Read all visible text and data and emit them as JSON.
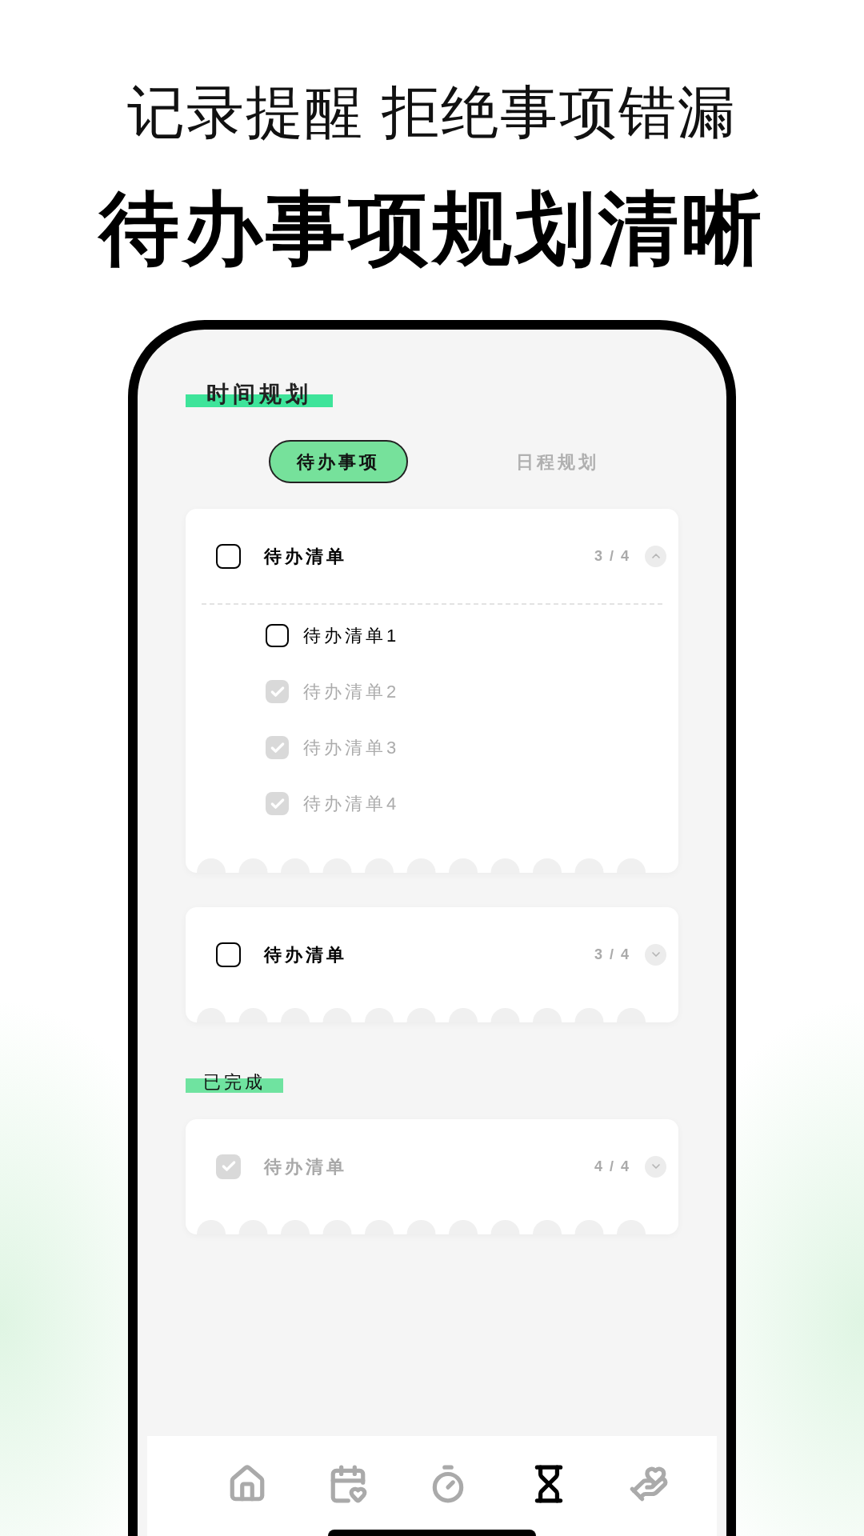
{
  "headline": {
    "line1": "记录提醒 拒绝事项错漏",
    "line2": "待办事项规划清晰"
  },
  "phone": {
    "section_title": "时间规划",
    "tabs": [
      {
        "label": "待办事项",
        "selected": true
      },
      {
        "label": "日程规划",
        "selected": false
      }
    ],
    "groups": [
      {
        "title": "待办清单",
        "checked": false,
        "count": "3 / 4",
        "expanded": true,
        "items": [
          {
            "label": "待办清单1",
            "checked": false
          },
          {
            "label": "待办清单2",
            "checked": true
          },
          {
            "label": "待办清单3",
            "checked": true
          },
          {
            "label": "待办清单4",
            "checked": true
          }
        ]
      },
      {
        "title": "待办清单",
        "checked": false,
        "count": "3 / 4",
        "expanded": false
      }
    ],
    "completed_title": "已完成",
    "completed_groups": [
      {
        "title": "待办清单",
        "checked": true,
        "count": "4 / 4",
        "expanded": false
      }
    ],
    "nav": [
      {
        "kind": "home",
        "selected": false
      },
      {
        "kind": "calendar",
        "selected": false
      },
      {
        "kind": "stopwatch",
        "selected": false
      },
      {
        "kind": "hourglass",
        "selected": true
      },
      {
        "kind": "care",
        "selected": false
      }
    ]
  }
}
